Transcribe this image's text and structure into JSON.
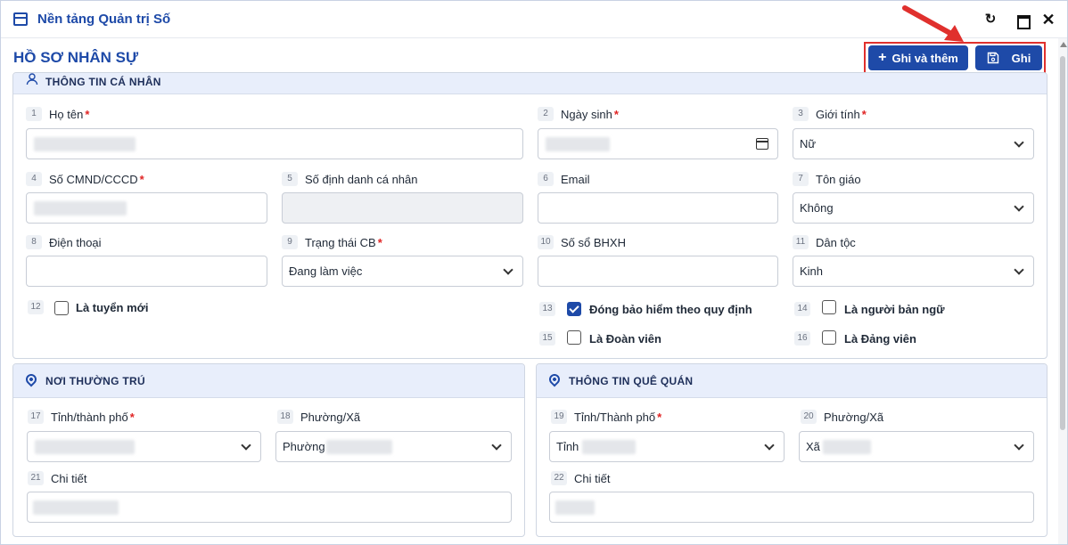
{
  "app": {
    "title": "Nền tảng Quản trị Số"
  },
  "page": {
    "title": "HỒ SƠ NHÂN SỰ"
  },
  "toolbar": {
    "save_add_label": "Ghi và thêm",
    "save_label": "Ghi"
  },
  "colors": {
    "primary": "#1e4aa8",
    "required": "#e02424",
    "highlight": "#e0302d"
  },
  "personal": {
    "section_title": "THÔNG TIN CÁ NHÂN",
    "fields": {
      "ho_ten": {
        "num": "1",
        "label": "Họ tên"
      },
      "ngay_sinh": {
        "num": "2",
        "label": "Ngày sinh"
      },
      "gioi_tinh": {
        "num": "3",
        "label": "Giới tính",
        "value": "Nữ"
      },
      "cmnd": {
        "num": "4",
        "label": "Số CMND/CCCD"
      },
      "dinh_danh": {
        "num": "5",
        "label": "Số định danh cá nhân"
      },
      "email": {
        "num": "6",
        "label": "Email"
      },
      "ton_giao": {
        "num": "7",
        "label": "Tôn giáo",
        "value": "Không"
      },
      "dien_thoai": {
        "num": "8",
        "label": "Điện thoại"
      },
      "trang_thai": {
        "num": "9",
        "label": "Trạng thái CB",
        "value": "Đang làm việc"
      },
      "so_bhxh": {
        "num": "10",
        "label": "Số sổ BHXH"
      },
      "dan_toc": {
        "num": "11",
        "label": "Dân tộc",
        "value": "Kinh"
      }
    },
    "checkboxes": {
      "tuyen_moi": {
        "num": "12",
        "label": "Là tuyển mới",
        "checked": false
      },
      "bao_hiem": {
        "num": "13",
        "label": "Đóng bảo hiểm theo quy định",
        "checked": true
      },
      "ban_ngu": {
        "num": "14",
        "label": "Là người bản ngữ",
        "checked": false
      },
      "doan_vien": {
        "num": "15",
        "label": "Là Đoàn viên",
        "checked": false
      },
      "dang_vien": {
        "num": "16",
        "label": "Là Đảng viên",
        "checked": false
      }
    }
  },
  "residence": {
    "section_title": "NƠI THƯỜNG TRÚ",
    "tinh": {
      "num": "17",
      "label": "Tỉnh/thành phố"
    },
    "phuong": {
      "num": "18",
      "label": "Phường/Xã",
      "value_prefix": "Phường"
    },
    "chi_tiet": {
      "num": "21",
      "label": "Chi tiết"
    }
  },
  "hometown": {
    "section_title": "THÔNG TIN QUÊ QUÁN",
    "tinh": {
      "num": "19",
      "label": "Tỉnh/Thành phố",
      "value_prefix": "Tỉnh"
    },
    "phuong": {
      "num": "20",
      "label": "Phường/Xã",
      "value_prefix": "Xã"
    },
    "chi_tiet": {
      "num": "22",
      "label": "Chi tiết"
    }
  },
  "icons": [
    "window-icon",
    "refresh-icon",
    "maximize-icon",
    "close-icon",
    "plus-icon",
    "save-icon",
    "user-icon",
    "pin-icon",
    "calendar-icon",
    "chevron-down-icon"
  ]
}
